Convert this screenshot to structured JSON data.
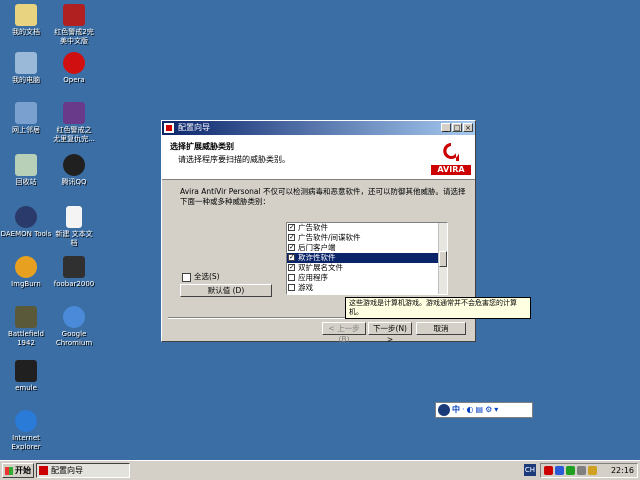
{
  "desktop": {
    "icons": [
      {
        "label": "我的文档"
      },
      {
        "label": "红色警戒2完\n美中文版"
      },
      {
        "label": "我的电脑"
      },
      {
        "label": "Opera"
      },
      {
        "label": "网上邻居"
      },
      {
        "label": "红色警戒之\n尤里复仇完..."
      },
      {
        "label": "回收站"
      },
      {
        "label": "腾讯QQ"
      },
      {
        "label": "DAEMON Tools"
      },
      {
        "label": "新建 文本文\n档"
      },
      {
        "label": "ImgBurn"
      },
      {
        "label": "foobar2000"
      },
      {
        "label": "Battlefield\n1942"
      },
      {
        "label": "Google\nChromium"
      },
      {
        "label": "emule"
      },
      {
        "label": "Internet\nExplorer"
      }
    ]
  },
  "dialog": {
    "title": "配置向导",
    "header_title": "选择扩展威胁类别",
    "header_subtitle": "请选择程序要扫描的威胁类别。",
    "logo_text": "AVIRA",
    "description": "Avira AntiVir Personal 不仅可以检测病毒和恶意软件，还可以防御其他威胁。请选择下面一种或多种威胁类别：",
    "categories": [
      {
        "label": "广告软件",
        "checked": true
      },
      {
        "label": "广告软件/间谍软件",
        "checked": true
      },
      {
        "label": "后门客户端",
        "checked": true
      },
      {
        "label": "欺诈性软件",
        "checked": true,
        "selected": true
      },
      {
        "label": "双扩展名文件",
        "checked": true
      },
      {
        "label": "应用程序",
        "checked": false
      },
      {
        "label": "游戏",
        "checked": false
      }
    ],
    "select_all_label": "全选(S)",
    "default_button": "默认值 (D)",
    "back_button": "< 上一步(B)",
    "next_button": "下一步(N) >",
    "cancel_button": "取消",
    "tooltip": "这些游戏是计算机游戏。游戏通常并不会危害您的计算机。"
  },
  "language_bar": {
    "lang": "中"
  },
  "taskbar": {
    "start_label": "开始",
    "task_label": "配置向导",
    "ime_label": "CH",
    "clock": "22:16"
  },
  "colors": {
    "desktop": "#3a6ea5",
    "title_active": "#0a246a",
    "avira_red": "#cc0000"
  }
}
